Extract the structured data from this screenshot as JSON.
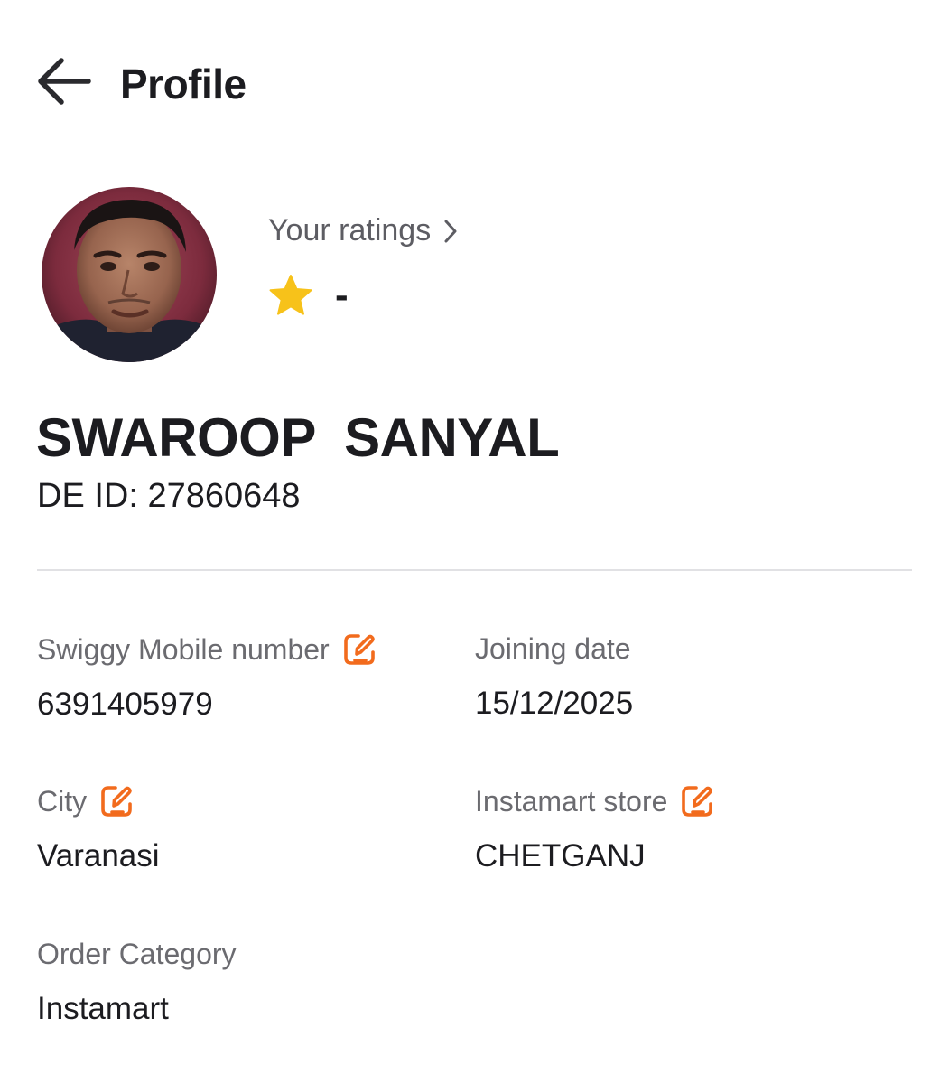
{
  "header": {
    "title": "Profile",
    "back_icon": "arrow-left-icon"
  },
  "profile": {
    "avatar_icon": "profile-photo",
    "ratings": {
      "label": "Your ratings",
      "star_icon": "star-icon",
      "value": "-"
    },
    "name": "SWAROOP  SANYAL",
    "de_id": "DE ID: 27860648"
  },
  "details": {
    "mobile": {
      "label": "Swiggy Mobile number",
      "value": "6391405979",
      "editable": true
    },
    "joining_date": {
      "label": "Joining date",
      "value": "15/12/2025"
    },
    "city": {
      "label": "City",
      "value": "Varanasi",
      "editable": true
    },
    "instamart_store": {
      "label": "Instamart store",
      "value": "CHETGANJ",
      "editable": true
    },
    "order_category": {
      "label": "Order Category",
      "value": "Instamart"
    }
  },
  "colors": {
    "accent_orange": "#f26b1d",
    "star_yellow": "#f7c21a",
    "text_primary": "#1c1c20",
    "text_secondary": "#6b6b70"
  }
}
